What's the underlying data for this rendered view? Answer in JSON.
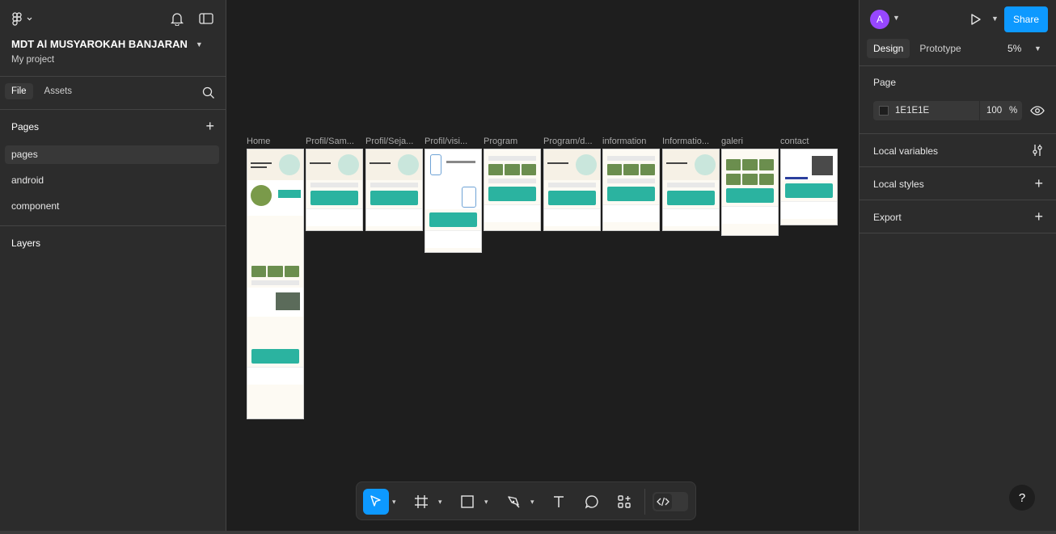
{
  "left_panel": {
    "project_title": "MDT Al MUSYAROKAH BANJARAN",
    "project_subtitle": "My project",
    "tabs": [
      "File",
      "Assets"
    ],
    "pages_label": "Pages",
    "pages": [
      "pages",
      "android",
      "component"
    ],
    "layers_label": "Layers"
  },
  "canvas": {
    "frames": [
      {
        "label": "Home"
      },
      {
        "label": "Profil/Sam..."
      },
      {
        "label": "Profil/Seja..."
      },
      {
        "label": "Profil/visi..."
      },
      {
        "label": "Program"
      },
      {
        "label": "Program/d..."
      },
      {
        "label": "information"
      },
      {
        "label": "Informatio..."
      },
      {
        "label": "galeri"
      },
      {
        "label": "contact"
      }
    ]
  },
  "right_panel": {
    "avatar_letter": "A",
    "share_label": "Share",
    "tabs": [
      "Design",
      "Prototype"
    ],
    "zoom": "5%",
    "page_label": "Page",
    "bg_color_hex": "1E1E1E",
    "bg_opacity": "100",
    "opacity_unit": "%",
    "local_variables": "Local variables",
    "local_styles": "Local styles",
    "export": "Export",
    "help": "?"
  },
  "colors": {
    "accent": "#0d99ff",
    "avatar": "#9747ff",
    "panel": "#2c2c2c",
    "canvas": "#1e1e1e"
  }
}
